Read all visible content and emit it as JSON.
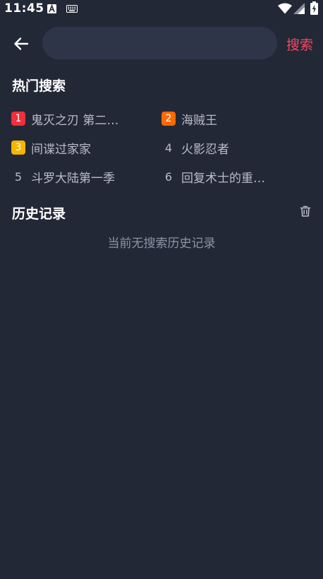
{
  "status_bar": {
    "time": "11:45",
    "icons": [
      "a-notification-icon",
      "keyboard-icon",
      "wifi-icon",
      "signal-icon",
      "battery-charging-icon"
    ]
  },
  "header": {
    "back_icon": "arrow-left-icon",
    "search_placeholder": "",
    "search_value": "",
    "search_label": "搜索"
  },
  "hot_search": {
    "title": "热门搜索",
    "items": [
      {
        "rank": "1",
        "label": "鬼灭之刃 第二…",
        "badge_color": "#f22f3c"
      },
      {
        "rank": "2",
        "label": "海贼王",
        "badge_color": "#ff6a00"
      },
      {
        "rank": "3",
        "label": "间谍过家家",
        "badge_color": "#f5b400"
      },
      {
        "rank": "4",
        "label": "火影忍者",
        "badge_color": null
      },
      {
        "rank": "5",
        "label": "斗罗大陆第一季",
        "badge_color": null
      },
      {
        "rank": "6",
        "label": "回复术士的重…",
        "badge_color": null
      }
    ]
  },
  "history": {
    "title": "历史记录",
    "clear_icon": "trash-icon",
    "empty_text": "当前无搜索历史记录"
  },
  "colors": {
    "background": "#232837",
    "search_box": "#2f3548",
    "accent": "#f04a64",
    "muted_text": "#b9bdca"
  }
}
